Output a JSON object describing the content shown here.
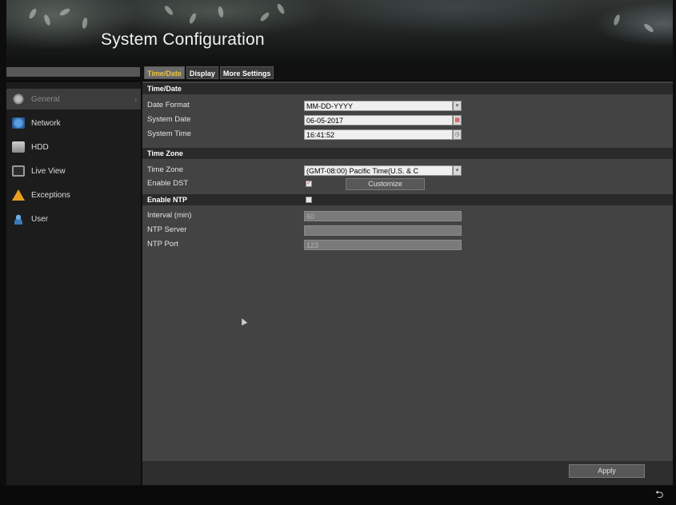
{
  "header": {
    "title": "System Configuration"
  },
  "tabs": [
    {
      "label": "Time/Date",
      "active": true
    },
    {
      "label": "Display",
      "active": false
    },
    {
      "label": "More Settings",
      "active": false
    }
  ],
  "sidebar": {
    "items": [
      {
        "label": "General",
        "icon": "gear-icon",
        "active": true
      },
      {
        "label": "Network",
        "icon": "network-icon",
        "active": false
      },
      {
        "label": "HDD",
        "icon": "hdd-icon",
        "active": false
      },
      {
        "label": "Live View",
        "icon": "monitor-icon",
        "active": false
      },
      {
        "label": "Exceptions",
        "icon": "warning-icon",
        "active": false
      },
      {
        "label": "User",
        "icon": "user-icon",
        "active": false
      }
    ]
  },
  "sections": {
    "time_date": "Time/Date",
    "time_zone": "Time Zone",
    "enable_ntp": "Enable NTP"
  },
  "fields": {
    "date_format": {
      "label": "Date Format",
      "value": "MM-DD-YYYY"
    },
    "system_date": {
      "label": "System Date",
      "value": "06-05-2017"
    },
    "system_time": {
      "label": "System Time",
      "value": "16:41:52"
    },
    "time_zone": {
      "label": "Time Zone",
      "value": "(GMT-08:00) Pacific Time(U.S. & C"
    },
    "enable_dst": {
      "label": "Enable DST",
      "checked": true
    },
    "enable_ntp": {
      "checked": false
    },
    "interval": {
      "label": "Interval (min)",
      "value": "60"
    },
    "ntp_server": {
      "label": "NTP Server",
      "value": ""
    },
    "ntp_port": {
      "label": "NTP Port",
      "value": "123"
    }
  },
  "buttons": {
    "customize": "Customize",
    "apply": "Apply"
  },
  "colors": {
    "active_tab_text": "#e8c340",
    "panel_bg": "#434343",
    "section_bg": "#2a2a2a"
  }
}
